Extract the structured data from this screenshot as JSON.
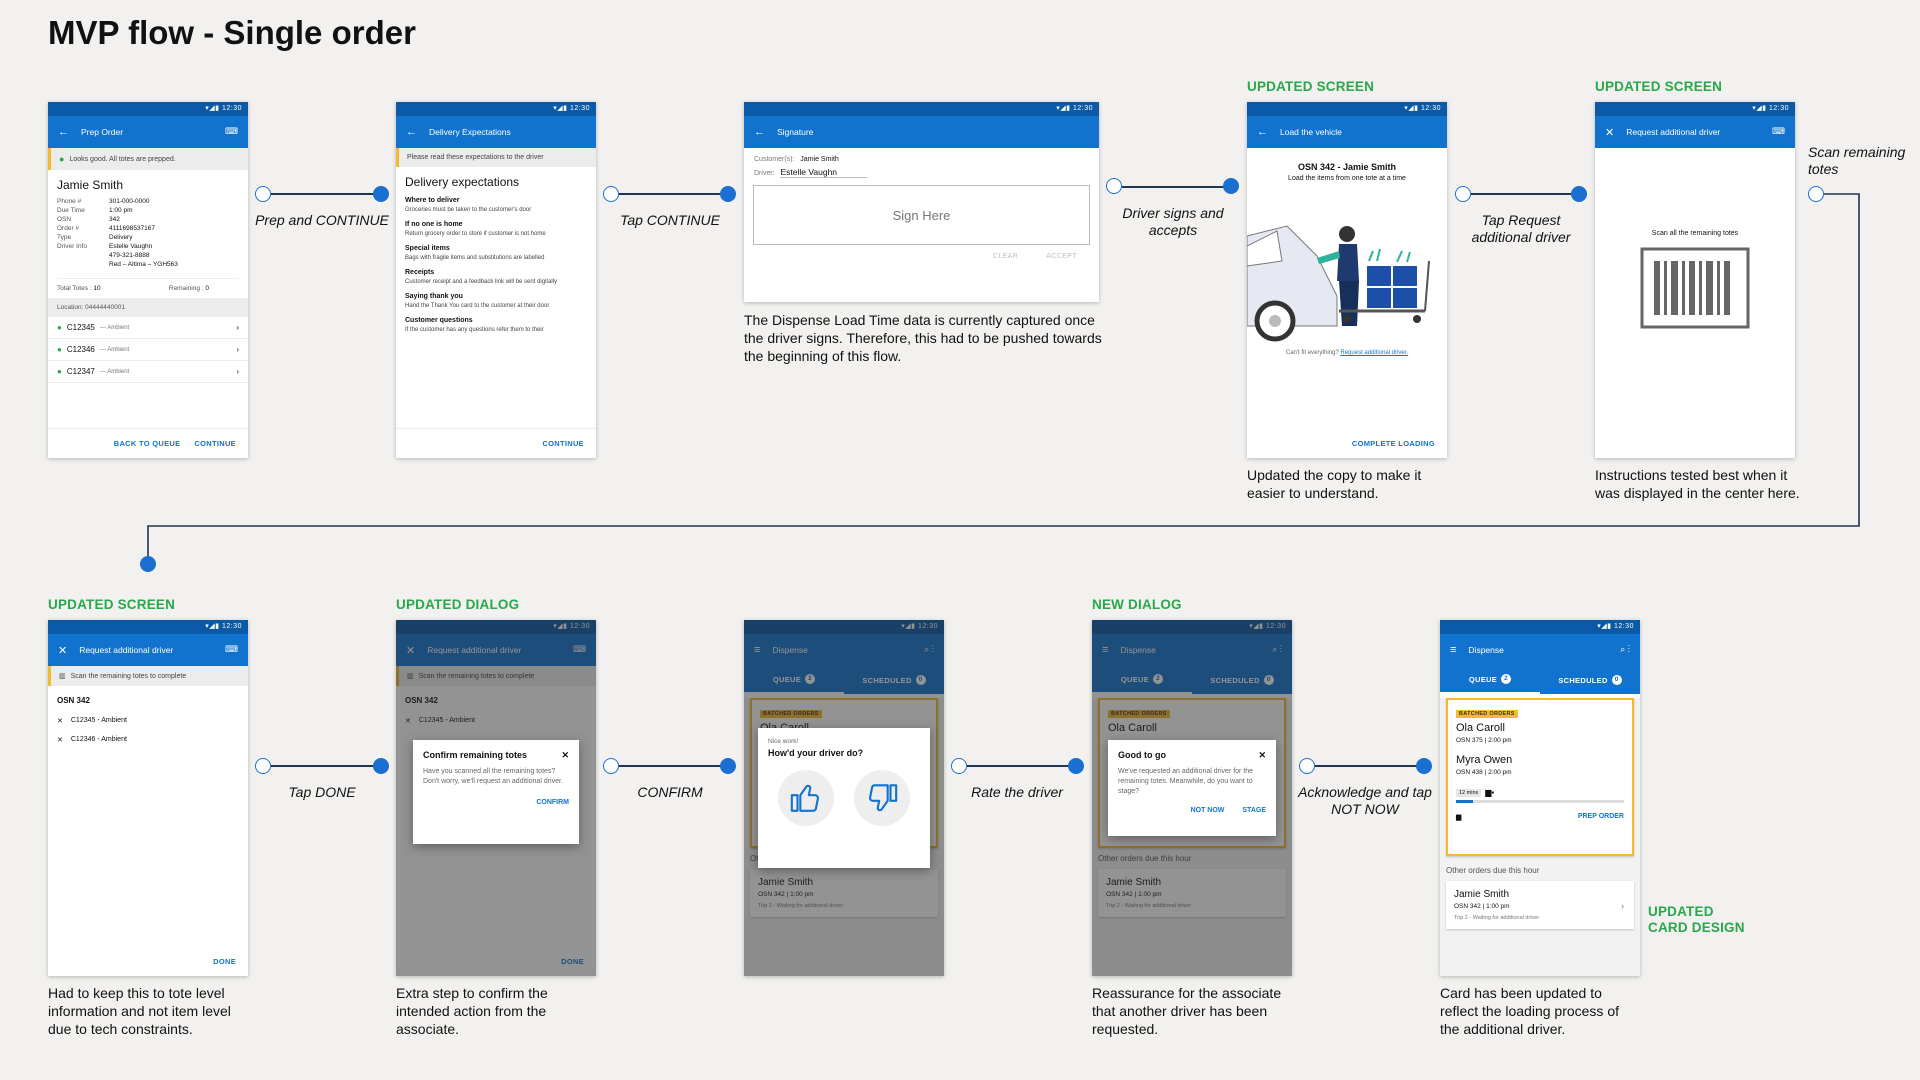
{
  "page": {
    "title": "MVP flow - Single order"
  },
  "colors": {
    "accent": "#1273cf",
    "appbar": "#1273cf",
    "statusbar": "#0a5aa8",
    "green": "#27a84a",
    "tag": "#f5b92b"
  },
  "tags": {
    "s4": "UPDATED SCREEN",
    "s5": "UPDATED SCREEN",
    "s6": "UPDATED SCREEN",
    "s7": "UPDATED DIALOG",
    "s9": "NEW DIALOG",
    "s10": "UPDATED\nCARD DESIGN"
  },
  "flow": {
    "l1": "Prep and CONTINUE",
    "l2": "Tap CONTINUE",
    "l3": "Driver signs and\naccepts",
    "l4": "Tap Request\nadditional driver",
    "l5": "Scan remaining\ntotes",
    "l6": "Tap DONE",
    "l7": "CONFIRM",
    "l8": "Rate the driver",
    "l9": "Acknowledge and tap\nNOT NOW"
  },
  "notes": {
    "s3": "The Dispense Load Time data is currently captured once the driver signs. Therefore, this had to be pushed towards the beginning of this flow.",
    "s4": "Updated the copy to make it easier to understand.",
    "s5": "Instructions tested best when it was displayed in the center here.",
    "s6": "Had to keep this to tote level information and not item level due to tech constraints.",
    "s7": "Extra step to confirm the intended action from the associate.",
    "s9": "Reassurance for the associate that another driver has been requested.",
    "s10": "Card has been updated to reflect the loading process of the additional driver."
  },
  "status": {
    "time": "12:30"
  },
  "s1": {
    "title": "Prep Order",
    "banner": "Looks good. All totes are prepped.",
    "name": "Jamie Smith",
    "fields": [
      {
        "k": "Phone #",
        "v": "301-000-0000"
      },
      {
        "k": "Due Time",
        "v": "1:00 pm"
      },
      {
        "k": "OSN",
        "v": "342"
      },
      {
        "k": "Order #",
        "v": "4111698537167"
      },
      {
        "k": "Type",
        "v": "Delivery"
      },
      {
        "k": "Driver Info",
        "v": "Estelle Vaughn"
      },
      {
        "k": "",
        "v": "479-321-8888"
      },
      {
        "k": "",
        "v": "Red – Altima – YGH563"
      }
    ],
    "total_label": "Total Totes :",
    "total": "10",
    "remain_label": "Remaining :",
    "remain": "0",
    "location": "Location: 04444440001",
    "totes": [
      {
        "id": "C12345",
        "t": "— Ambient"
      },
      {
        "id": "C12346",
        "t": "— Ambient"
      },
      {
        "id": "C12347",
        "t": "— Ambient"
      }
    ],
    "back": "BACK TO QUEUE",
    "cont": "CONTINUE"
  },
  "s2": {
    "title": "Delivery Expectations",
    "banner": "Please read these expectations to the driver",
    "heading": "Delivery expectations",
    "items": [
      {
        "h": "Where to deliver",
        "b": "Groceries must be taken to the customer's door"
      },
      {
        "h": "If no one is home",
        "b": "Return grocery order to store if customer is not home"
      },
      {
        "h": "Special items",
        "b": "Bags with fragile items and substitutions are labelled"
      },
      {
        "h": "Receipts",
        "b": "Customer receipt and a feedback link will be sent digitally"
      },
      {
        "h": "Saying thank you",
        "b": "Hand the Thank You card to the customer at their door"
      },
      {
        "h": "Customer questions",
        "b": "If the customer has any questions refer them to their"
      }
    ],
    "cont": "CONTINUE"
  },
  "s3": {
    "title": "Signature",
    "cust_label": "Customer(s):",
    "cust": "Jamie Smith",
    "drv_label": "Driver:",
    "drv": "Estelle Vaughn",
    "sign": "Sign Here",
    "clear": "CLEAR",
    "accept": "ACCEPT"
  },
  "s4": {
    "title": "Load the vehicle",
    "osn": "OSN 342 - Jamie Smith",
    "sub": "Load the items from one tote at a time",
    "cant": "Can't fit everything?",
    "link": "Request additional driver.",
    "btn": "COMPLETE LOADING"
  },
  "s5": {
    "title": "Request additional driver",
    "scan": "Scan all the remaining totes"
  },
  "s6": {
    "title": "Request additional driver",
    "banner": "Scan the remaining totes to complete",
    "osn": "OSN 342",
    "totes": [
      "C12345 - Ambient",
      "C12346 - Ambient"
    ],
    "done": "DONE"
  },
  "s7": {
    "title": "Request additional driver",
    "banner": "Scan the remaining totes to complete",
    "osn": "OSN 342",
    "tote": "C12345 - Ambient",
    "dlg_title": "Confirm remaining totes",
    "dlg_body": "Have you scanned all the remaining totes? Don't worry, we'll request an additional driver.",
    "dlg_btn": "CONFIRM",
    "done": "DONE"
  },
  "disp": {
    "title": "Dispense",
    "queue": "QUEUE",
    "qn": "2",
    "sched": "SCHEDULED",
    "sn": "0",
    "batched": "BATCHED ORDERS",
    "c1name": "Ola Caroll",
    "c1osn": "OSN 375",
    "c1t": "2:00 pm",
    "c2name": "Myra Owen",
    "c2osn": "OSN 438",
    "c2t": "2:00 pm",
    "mins": "12 mins",
    "prep": "PREP ORDER",
    "other": "Other orders due this hour",
    "jname": "Jamie Smith",
    "josn": "OSN 342",
    "jt": "1:00 pm",
    "trip": "Trip 2 - Waiting for additional driver"
  },
  "s8": {
    "small": "Nice work!",
    "q": "How'd your driver do?"
  },
  "s9": {
    "dlg_title": "Good to go",
    "dlg_body": "We've requested an additional driver for the remaining totes. Meanwhile, do you want to stage?",
    "not_now": "NOT NOW",
    "stage": "STAGE"
  }
}
